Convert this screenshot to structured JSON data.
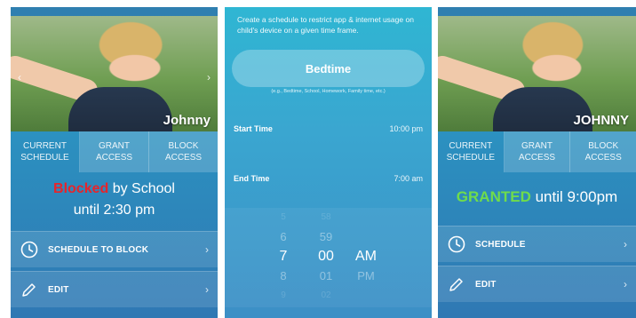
{
  "screen1": {
    "child_name": "Johnny",
    "tabs": [
      {
        "label_l1": "CURRENT",
        "label_l2": "SCHEDULE"
      },
      {
        "label_l1": "GRANT",
        "label_l2": "ACCESS"
      },
      {
        "label_l1": "BLOCK",
        "label_l2": "ACCESS"
      }
    ],
    "status": {
      "blocked_word": "Blocked",
      "by_text": " by School",
      "until_text": "until 2:30 pm"
    },
    "actions": [
      {
        "label": "SCHEDULE TO BLOCK",
        "icon": "clock-icon"
      },
      {
        "label": "EDIT",
        "icon": "pencil-icon"
      }
    ]
  },
  "screen2": {
    "intro_text": "Create a schedule to restrict app & internet usage on child's device on a given time frame.",
    "schedule_name": "Bedtime",
    "hint": "(e.g., Bedtime, School, Homework, Family time, etc.)",
    "start_label": "Start Time",
    "start_value": "10:00 pm",
    "end_label": "End Time",
    "end_value": "7:00 am",
    "picker": {
      "hours": [
        "5",
        "6",
        "7",
        "8",
        "9"
      ],
      "minutes": [
        "58",
        "59",
        "00",
        "01",
        "02"
      ],
      "ampm": [
        "",
        "",
        "AM",
        "PM",
        ""
      ]
    }
  },
  "screen3": {
    "child_name": "JOHNNY",
    "tabs": [
      {
        "label_l1": "CURRENT",
        "label_l2": "SCHEDULE"
      },
      {
        "label_l1": "GRANT",
        "label_l2": "ACCESS"
      },
      {
        "label_l1": "BLOCK",
        "label_l2": "ACCESS"
      }
    ],
    "status": {
      "granted_word": "GRANTED",
      "until_text": " until 9:00pm"
    },
    "actions": [
      {
        "label": "SCHEDULE",
        "icon": "clock-icon"
      },
      {
        "label": "EDIT",
        "icon": "pencil-icon"
      }
    ]
  },
  "colors": {
    "blocked_red": "#e8242a",
    "granted_green": "#6fdc4c",
    "bg_blue": "#2c8fbf"
  }
}
